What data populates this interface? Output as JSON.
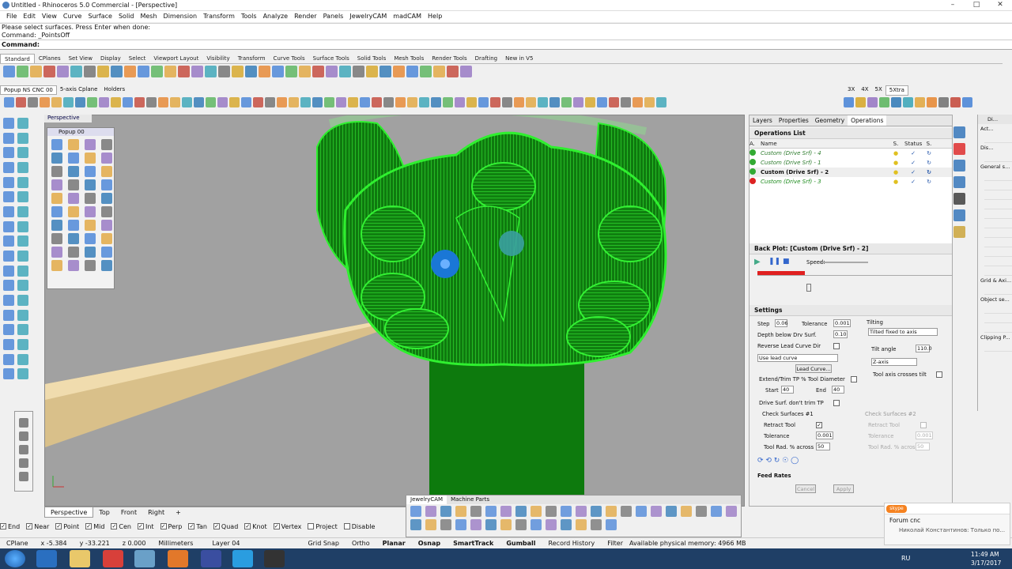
{
  "window": {
    "title": "Untitled - Rhinoceros 5.0 Commercial - [Perspective]"
  },
  "menu": [
    "File",
    "Edit",
    "View",
    "Curve",
    "Surface",
    "Solid",
    "Mesh",
    "Dimension",
    "Transform",
    "Tools",
    "Analyze",
    "Render",
    "Panels",
    "JewelryCAM",
    "madCAM",
    "Help"
  ],
  "command": {
    "line1": "Please select surfaces. Press Enter when done:",
    "line2": "Command: _PointsOff",
    "prompt": "Command:"
  },
  "toolbar_tabs": [
    "Standard",
    "CPlanes",
    "Set View",
    "Display",
    "Select",
    "Viewport Layout",
    "Visibility",
    "Transform",
    "Curve Tools",
    "Surface Tools",
    "Solid Tools",
    "Mesh Tools",
    "Render Tools",
    "Drafting",
    "New in V5"
  ],
  "toolbar2_tabs": [
    "Popup NS CNC 00",
    "5-axis Cplane",
    "Holders"
  ],
  "toolbar2_right": [
    "3X",
    "4X",
    "5X",
    "5Xtra"
  ],
  "viewport": {
    "label": "Perspective",
    "popup_title": "Popup 00"
  },
  "view_tabs": [
    "Perspective",
    "Top",
    "Front",
    "Right"
  ],
  "osnap": [
    {
      "label": "End",
      "on": true
    },
    {
      "label": "Near",
      "on": true
    },
    {
      "label": "Point",
      "on": true
    },
    {
      "label": "Mid",
      "on": true
    },
    {
      "label": "Cen",
      "on": true
    },
    {
      "label": "Int",
      "on": true
    },
    {
      "label": "Perp",
      "on": true
    },
    {
      "label": "Tan",
      "on": true
    },
    {
      "label": "Quad",
      "on": true
    },
    {
      "label": "Knot",
      "on": true
    },
    {
      "label": "Vertex",
      "on": true
    },
    {
      "label": "Project",
      "on": false
    },
    {
      "label": "Disable",
      "on": false
    }
  ],
  "status": {
    "cplane": "CPlane",
    "x": "x -5.384",
    "y": "y -33.221",
    "z": "z 0.000",
    "units": "Millimeters",
    "layer": "Layer 04",
    "grid": "Grid Snap",
    "ortho": "Ortho",
    "planar": "Planar",
    "osnap": "Osnap",
    "smarttrack": "SmartTrack",
    "gumball": "Gumball",
    "history": "Record History",
    "filter": "Filter",
    "memory": "Available physical memory: 4966 MB"
  },
  "panel": {
    "tabs": [
      "Layers",
      "Properties",
      "Geometry",
      "Operations"
    ],
    "ops_header": "Operations List",
    "cols": [
      "A.",
      "Name",
      "S.",
      "Status",
      "S."
    ],
    "ops": [
      {
        "name": "Custom (Drive Srf) - 4",
        "state": "green"
      },
      {
        "name": "Custom (Drive Srf) - 1",
        "state": "green"
      },
      {
        "name": "Custom (Drive Srf) - 2",
        "state": "green"
      },
      {
        "name": "Custom (Drive Srf) - 3",
        "state": "red"
      }
    ],
    "backplot": "Back Plot: [Custom (Drive Srf) - 2]",
    "speed": "Speed:",
    "settings": "Settings",
    "step_label": "Step",
    "step": "0.06",
    "tol_label": "Tolerance",
    "tol": "0.001",
    "tilting": "Tilting",
    "tilt_mode": "Tilted fixed to axis",
    "depth_label": "Depth below Drv Surf.",
    "depth": "0.10",
    "reverse": "Reverse Lead Curve Dir",
    "lead_select": "Use lead curve",
    "lead_btn": "Lead Curve...",
    "tilt_angle_label": "Tilt angle",
    "tilt_angle": "110.0",
    "axis_select": "Z-axis",
    "crosses": "Tool axis crosses tilt",
    "extend": "Extend/Trim TP % Tool Diameter",
    "start_label": "Start",
    "start": "40",
    "end_label": "End",
    "end": "40",
    "drive_trim": "Drive Surf. don't trim TP",
    "check1": "Check Surfaces #1",
    "check2": "Check Surfaces #2",
    "retract": "Retract Tool",
    "tol2_label": "Tolerance",
    "tol2": "0.001",
    "rad_label": "Tool Rad. % across",
    "rad": "50",
    "feed": "Feed Rates",
    "cancel": "Cancel",
    "apply": "Apply"
  },
  "rpanel": {
    "title": "Di...",
    "items": [
      "Act...",
      "Dis...",
      "General s...",
      "Grid & Axi...",
      "Object se...",
      "Clipping P..."
    ]
  },
  "mpanel": {
    "tabs": [
      "JewelryCAM",
      "Machine Parts"
    ]
  },
  "skype": {
    "brand": "skype",
    "title": "Forum cnc",
    "msg": "Николай Константинов: Только по..."
  },
  "taskbar": {
    "lang": "RU",
    "time": "11:49 AM",
    "date": "3/17/2017"
  },
  "colors": {
    "green_mesh": "#1fc81f",
    "viewport_bg": "#a1a1a1",
    "tool": "#d9c08a"
  }
}
